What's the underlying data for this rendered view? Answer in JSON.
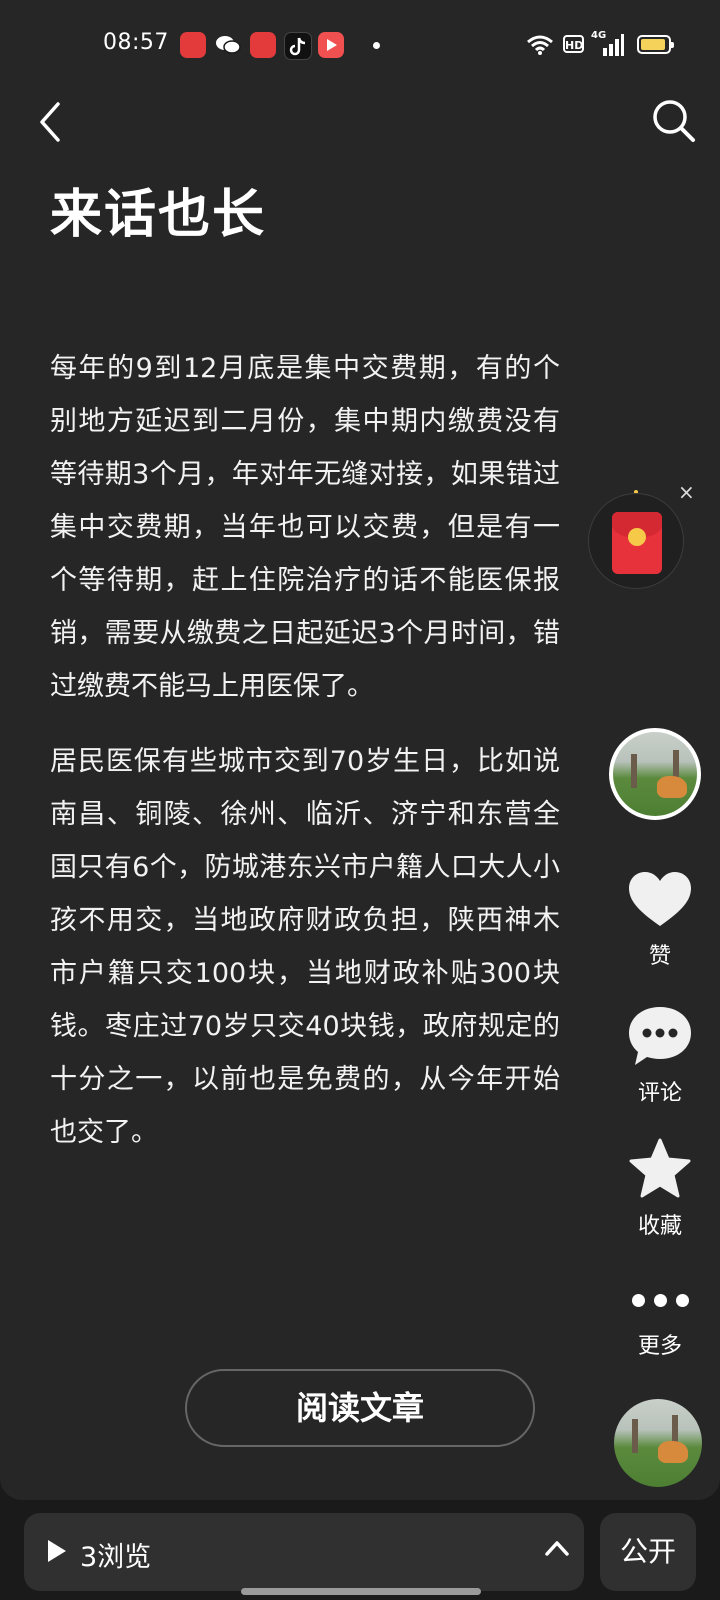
{
  "status_bar": {
    "time": "08:57",
    "network": "4G",
    "hd_label": "HD",
    "app_icons": [
      {
        "name": "toutiao-icon",
        "color": "#e33b3b"
      },
      {
        "name": "wechat-icon",
        "color": "#ffffff"
      },
      {
        "name": "toutiao-lite-icon",
        "color": "#e33b3b"
      },
      {
        "name": "douyin-icon",
        "color": "#111111"
      },
      {
        "name": "video-app-icon",
        "color": "#f05050"
      }
    ]
  },
  "header": {
    "title": "来话也长"
  },
  "article": {
    "paragraphs": [
      "每年的9到12月底是集中交费期，有的个别地方延迟到二月份，集中期内缴费没有等待期3个月，年对年无缝对接，如果错过集中交费期，当年也可以交费，但是有一个等待期，赶上住院治疗的话不能医保报销，需要从缴费之日起延迟3个月时间，错过缴费不能马上用医保了。",
      "居民医保有些城市交到70岁生日，比如说南昌、铜陵、徐州、临沂、济宁和东营全国只有6个，防城港东兴市户籍人口大人小孩不用交，当地政府财政负担，陕西神木市户籍只交100块，当地财政补贴300块钱。枣庄过70岁只交40块钱，政府规定的十分之一，以前也是免费的，从今年开始也交了。"
    ],
    "read_button": "阅读文章"
  },
  "rail": {
    "like_label": "赞",
    "comment_label": "评论",
    "favorite_label": "收藏",
    "more_label": "更多",
    "close_symbol": "×"
  },
  "bottom": {
    "views_text": "3浏览",
    "public_label": "公开"
  },
  "colors": {
    "background": "#262626",
    "accent_red": "#e8323b",
    "battery": "#f5d25a"
  }
}
